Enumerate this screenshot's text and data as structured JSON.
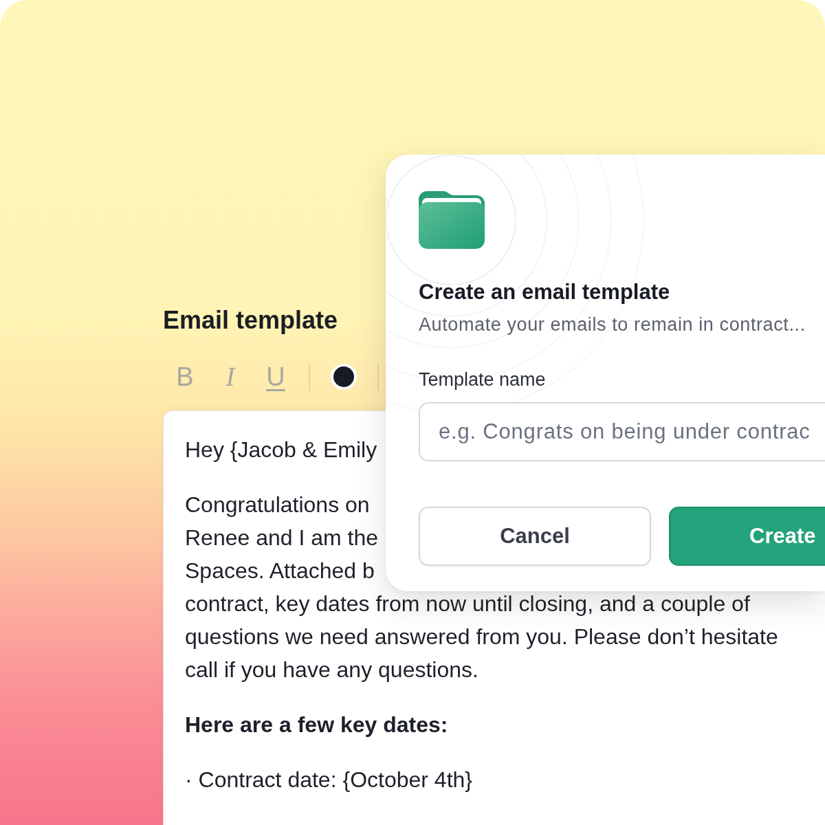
{
  "editor": {
    "title": "Email template",
    "format_buttons": [
      {
        "kind": "bold",
        "label": "B"
      },
      {
        "kind": "italic",
        "label": "I"
      },
      {
        "kind": "underline",
        "label": "U"
      }
    ],
    "body": [
      {
        "kind": "paragraph",
        "lines": [
          "Hey {Jacob & Emily"
        ]
      },
      {
        "kind": "paragraph",
        "lines": [
          "Congratulations on",
          "Renee and I am the",
          "Spaces. Attached b",
          "contract, key dates from now until closing, and a couple of",
          "questions we need answered from you. Please don’t hesitate",
          "call if you have any questions."
        ]
      },
      {
        "kind": "heading",
        "lines": [
          "Here are a few key dates:"
        ]
      },
      {
        "kind": "paragraph",
        "lines": [
          "· Contract date: {October 4th}"
        ]
      }
    ]
  },
  "dialog": {
    "title": "Create an email template",
    "subtitle": "Automate your emails to remain in contract...",
    "field": {
      "label": "Template name",
      "placeholder": "e.g. Congrats on being under contrac"
    },
    "buttons": [
      {
        "kind": "secondary",
        "label": "Cancel"
      },
      {
        "kind": "primary",
        "label": "Create"
      }
    ]
  }
}
